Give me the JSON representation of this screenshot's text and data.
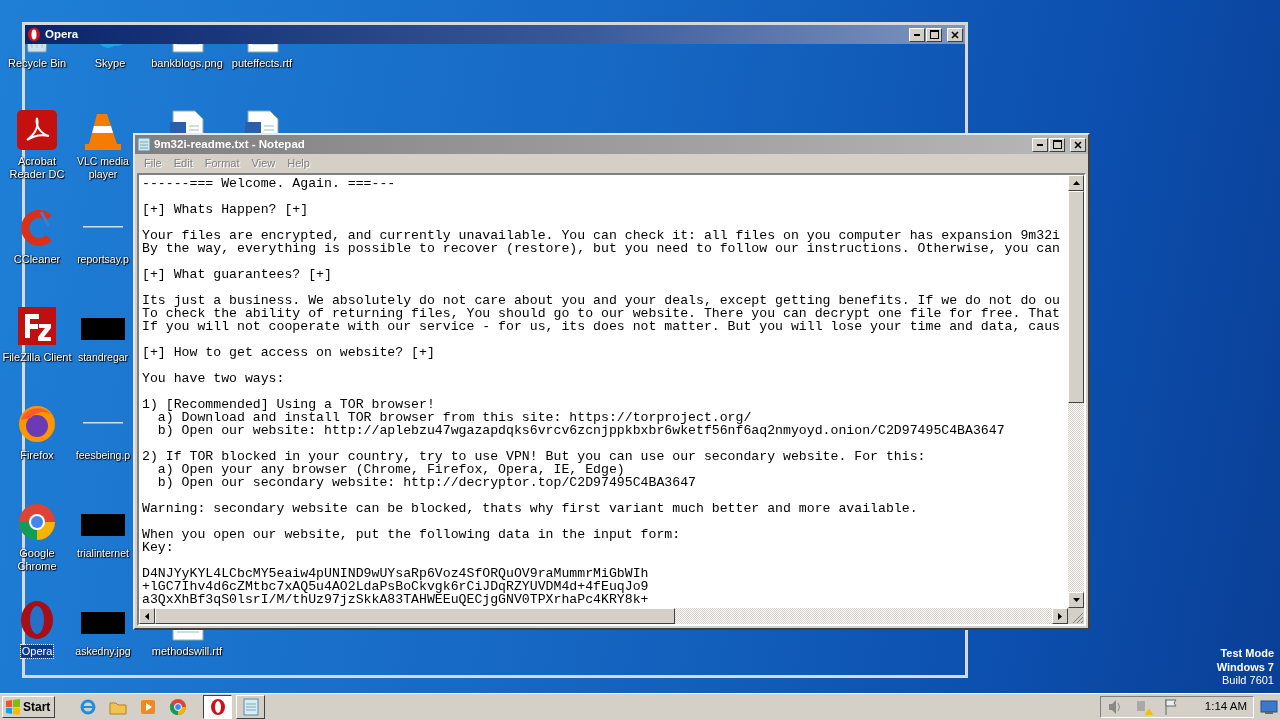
{
  "desktop": {
    "icon_columns": [
      [
        {
          "label": "Recycle Bin",
          "kind": "recycle",
          "selected": false
        },
        {
          "label": "Acrobat Reader DC",
          "kind": "pdf",
          "selected": false
        },
        {
          "label": "CCleaner",
          "kind": "ccleaner",
          "selected": false
        },
        {
          "label": "FileZilla Client",
          "kind": "filezilla",
          "selected": false
        },
        {
          "label": "Firefox",
          "kind": "firefox",
          "selected": false
        },
        {
          "label": "Google Chrome",
          "kind": "chrome",
          "selected": false
        },
        {
          "label": "Opera",
          "kind": "opera",
          "selected": true
        }
      ],
      [
        {
          "label": "Skype",
          "kind": "skype",
          "selected": false
        },
        {
          "label": "VLC media player",
          "kind": "vlc",
          "selected": false
        },
        {
          "label": "reportsay.p",
          "kind": "blank",
          "selected": false
        },
        {
          "label": "standregar",
          "kind": "dark",
          "selected": false
        },
        {
          "label": "feesbeing.p",
          "kind": "blank",
          "selected": false
        },
        {
          "label": "trialinternet",
          "kind": "dark",
          "selected": false
        },
        {
          "label": "askedny.jpg",
          "kind": "dark",
          "selected": false
        }
      ],
      [
        {
          "label": "bankblogs.png",
          "kind": "doc",
          "selected": false
        },
        {
          "kind": "doc"
        },
        null,
        null,
        null,
        null,
        {
          "label": "methodswill.rtf",
          "kind": "doc",
          "selected": false
        }
      ],
      [
        {
          "label": "puteffects.rtf",
          "kind": "doc",
          "selected": false
        },
        {
          "kind": "doc"
        }
      ]
    ],
    "system_lines": [
      "Test Mode",
      "Windows 7",
      "Build 7601"
    ]
  },
  "opera_window": {
    "title": "Opera"
  },
  "notepad": {
    "title": "9m32i-readme.txt - Notepad",
    "menu": [
      "File",
      "Edit",
      "Format",
      "View",
      "Help"
    ],
    "blocks": [
      [
        "------=== Welcome. Again. ===---"
      ],
      [
        "[+] Whats Happen? [+]"
      ],
      [
        "Your files are encrypted, and currently unavailable. You can check it: all files on you computer has expansion 9m32i",
        "By the way, everything is possible to recover (restore), but you need to follow our instructions. Otherwise, you can"
      ],
      [
        "[+] What guarantees? [+]"
      ],
      [
        "Its just a business. We absolutely do not care about you and your deals, except getting benefits. If we do not do ou",
        "To check the ability of returning files, You should go to our website. There you can decrypt one file for free. That",
        "If you will not cooperate with our service - for us, its does not matter. But you will lose your time and data, caus"
      ],
      [
        "[+] How to get access on website? [+]"
      ],
      [
        "You have two ways:"
      ],
      [
        "1) [Recommended] Using a TOR browser!",
        "  a) Download and install TOR browser from this site: https://torproject.org/",
        "  b) Open our website: http://aplebzu47wgazapdqks6vrcv6zcnjppkbxbr6wketf56nf6aq2nmyoyd.onion/C2D97495C4BA3647"
      ],
      [
        "2) If TOR blocked in your country, try to use VPN! But you can use our secondary website. For this:",
        "  a) Open your any browser (Chrome, Firefox, Opera, IE, Edge)",
        "  b) Open our secondary website: http://decryptor.top/C2D97495C4BA3647"
      ],
      [
        "Warning: secondary website can be blocked, thats why first variant much better and more available."
      ],
      [
        "When you open our website, put the following data in the input form:",
        "Key:"
      ],
      [
        "D4NJYyKYL4LCbcMY5eaiw4pUNIND9wUYsaRp6Voz4SfORQuOV9raMummrMiGbWIh",
        "+lGC7Ihv4d6cZMtbc7xAQ5u4AO2LdaPsBoCkvgk6rCiJDqRZYUVDM4d+4fEuqJo9",
        "a3QxXhBf3qS0lsrI/M/thUz97jzSkkA83TAHWEEuQECjgGNV0TPXrhaPc4KRY8k+"
      ]
    ]
  },
  "taskbar": {
    "start": "Start",
    "pinned": [
      {
        "kind": "ie"
      },
      {
        "kind": "explorer"
      },
      {
        "kind": "media"
      },
      {
        "kind": "chrome"
      }
    ],
    "tasks": [
      {
        "kind": "opera",
        "selected": true
      },
      {
        "kind": "notepad",
        "selected": false
      }
    ],
    "tray": [
      {
        "kind": "volume"
      },
      {
        "kind": "network"
      },
      {
        "kind": "flag"
      }
    ],
    "clock": "1:14 AM"
  }
}
